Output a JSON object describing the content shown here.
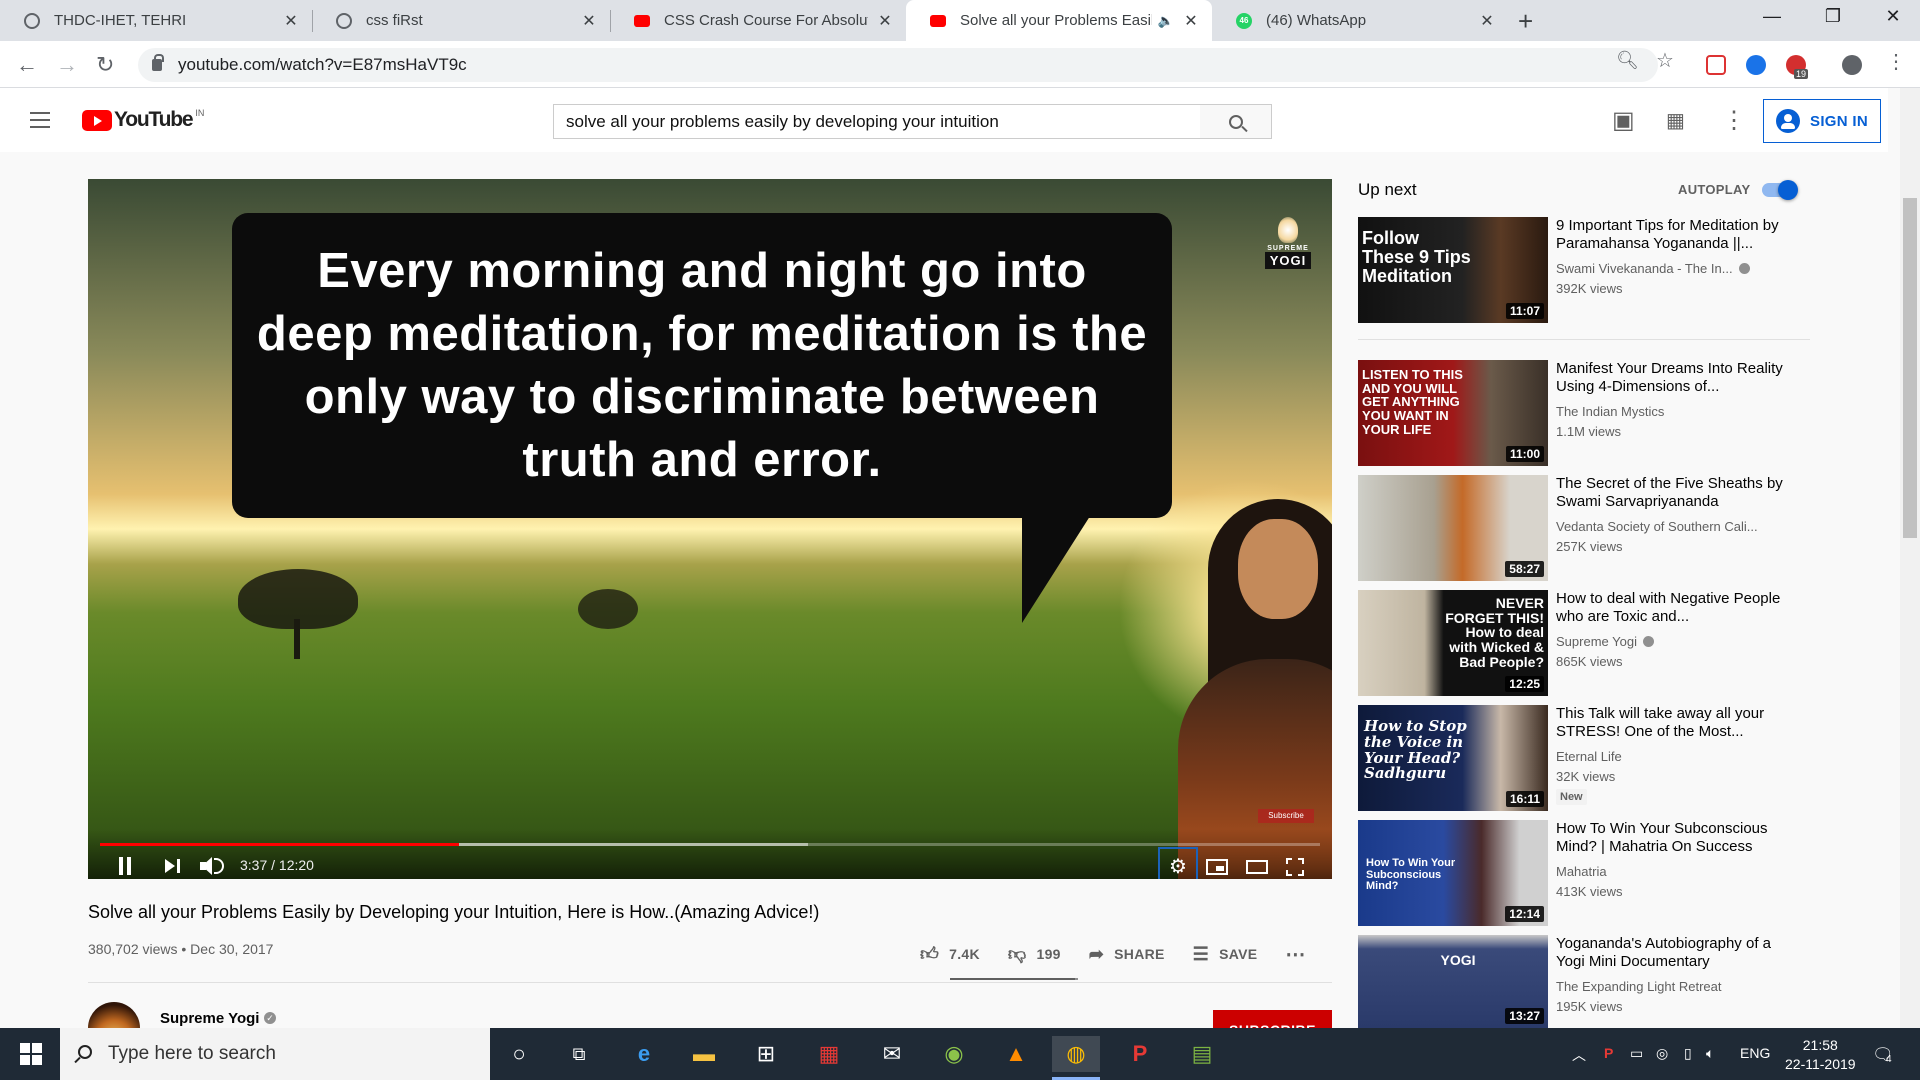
{
  "browser": {
    "tabs": [
      {
        "title": "THDC-IHET, TEHRI",
        "icon": "globe-icon"
      },
      {
        "title": "css fiRst",
        "icon": "globe-icon"
      },
      {
        "title": "CSS Crash Course For Absolute B",
        "icon": "youtube-icon"
      },
      {
        "title": "Solve all your Problems Easily",
        "icon": "youtube-icon",
        "active": true
      },
      {
        "title": "(46) WhatsApp",
        "icon": "whatsapp-icon",
        "badge": "46"
      }
    ],
    "url": "youtube.com/watch?v=E87msHaVT9c",
    "extension_badge": "19"
  },
  "youtube": {
    "logo_text": "YouTube",
    "country_code": "IN",
    "search_value": "solve all your problems easily by developing your intuition",
    "sign_in_label": "SIGN IN"
  },
  "player": {
    "overlay_quote": "Every morning and night go into deep meditation, for meditation is the only way to discriminate between truth and error.",
    "brand_top": "SUPREME",
    "brand_name": "YOGI",
    "subscribe_watermark": "Subscribe",
    "time_display": "3:37 / 12:20",
    "progress_played_fraction": 0.294,
    "progress_buffered_fraction": 0.58
  },
  "video": {
    "title": "Solve all your Problems Easily by Developing your Intuition, Here is How..(Amazing Advice!)",
    "views": "380,702 views",
    "date": "Dec 30, 2017",
    "views_and_date": "380,702 views • Dec 30, 2017",
    "likes": "7.4K",
    "dislikes": "199",
    "share_label": "SHARE",
    "save_label": "SAVE",
    "like_fraction": 0.974,
    "channel_name": "Supreme Yogi",
    "subscribe_label": "SUBSCRIBE"
  },
  "sidebar": {
    "up_next_label": "Up next",
    "autoplay_label": "AUTOPLAY",
    "autoplay_on": true,
    "items": [
      {
        "title": "9 Important Tips for Meditation by Paramahansa Yogananda ||...",
        "channel": "Swami Vivekananda - The In...",
        "verified": true,
        "views": "392K views",
        "duration": "11:07",
        "thumb_text": "Follow These 9 Tips Meditation"
      },
      {
        "title": "Manifest Your Dreams Into Reality Using 4-Dimensions of...",
        "channel": "The Indian Mystics",
        "verified": false,
        "views": "1.1M views",
        "duration": "11:00",
        "thumb_text": "LISTEN TO THIS AND YOU WILL GET ANYTHING YOU WANT IN YOUR LIFE"
      },
      {
        "title": "The Secret of the Five Sheaths by Swami Sarvapriyananda",
        "channel": "Vedanta Society of Southern Cali...",
        "verified": false,
        "views": "257K views",
        "duration": "58:27",
        "thumb_text": ""
      },
      {
        "title": "How to deal with Negative People who are Toxic and...",
        "channel": "Supreme Yogi",
        "verified": true,
        "views": "865K views",
        "duration": "12:25",
        "thumb_text": "NEVER FORGET THIS! How to deal with Wicked & Bad People?"
      },
      {
        "title": "This Talk will take away all your STRESS! One of the Most...",
        "channel": "Eternal Life",
        "verified": false,
        "views": "32K views",
        "duration": "16:11",
        "badge": "New",
        "thumb_text": "How to Stop the Voice in Your Head? Sadhguru"
      },
      {
        "title": "How To Win Your Subconscious Mind? | Mahatria On Success",
        "channel": "Mahatria",
        "verified": false,
        "views": "413K views",
        "duration": "12:14",
        "thumb_text": "How To Win Your Subconscious Mind?"
      },
      {
        "title": "Yogananda's Autobiography of a Yogi Mini Documentary",
        "channel": "The Expanding Light Retreat",
        "verified": false,
        "views": "195K views",
        "duration": "13:27",
        "thumb_text": "YOGI"
      }
    ]
  },
  "taskbar": {
    "search_placeholder": "Type here to search",
    "language": "ENG",
    "time": "21:58",
    "date": "22-11-2019",
    "notification_count": "4"
  },
  "colors": {
    "youtube_red": "#ff0000",
    "link_blue": "#065fd4",
    "subscribe_red": "#cc0000"
  }
}
